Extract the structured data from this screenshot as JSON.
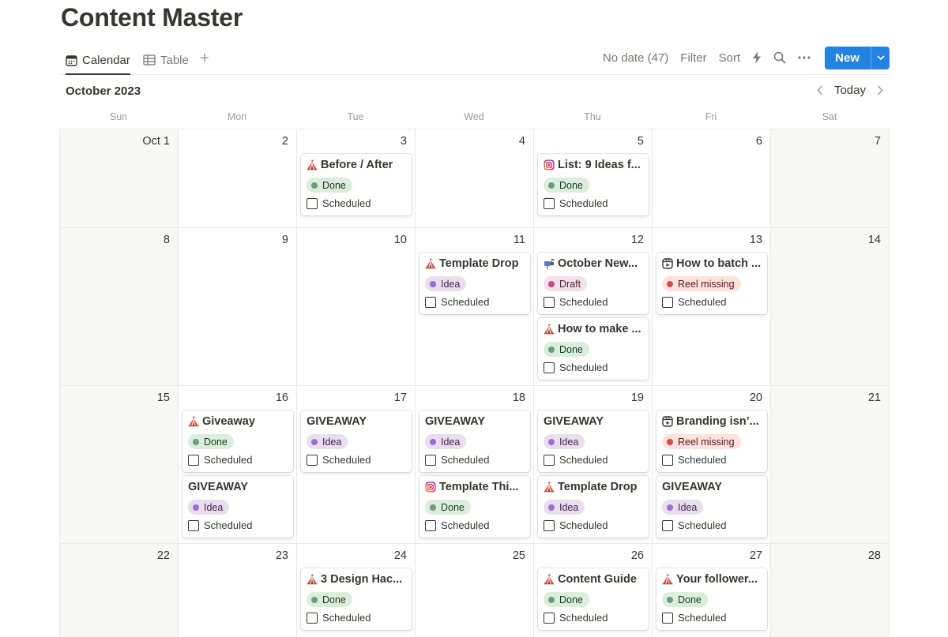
{
  "page": {
    "title": "Content Master"
  },
  "views": {
    "tabs": [
      {
        "label": "Calendar",
        "icon": "calendar-icon",
        "active": true
      },
      {
        "label": "Table",
        "icon": "table-icon",
        "active": false
      }
    ],
    "add_view": "+"
  },
  "toolbar": {
    "no_date": "No date (47)",
    "filter": "Filter",
    "sort": "Sort",
    "new_label": "New"
  },
  "calendar": {
    "month_label": "October 2023",
    "today_label": "Today",
    "weekdays": [
      "Sun",
      "Mon",
      "Tue",
      "Wed",
      "Thu",
      "Fri",
      "Sat"
    ],
    "checkbox_label": "Scheduled",
    "status_colors": {
      "Done": "#dbeddb",
      "Idea": "#e8deee",
      "Draft": "#f5e0e9",
      "Reel missing": "#ffe2dd"
    },
    "weeks": [
      {
        "days": [
          {
            "label": "Oct 1",
            "weekend": true,
            "cards": []
          },
          {
            "label": "2",
            "cards": []
          },
          {
            "label": "3",
            "cards": [
              {
                "icon": "tent-icon",
                "title": "Before / After",
                "status": "Done",
                "kind": "done"
              }
            ]
          },
          {
            "label": "4",
            "cards": []
          },
          {
            "label": "5",
            "cards": [
              {
                "icon": "instagram-icon",
                "title": "List: 9 Ideas f...",
                "status": "Done",
                "kind": "done"
              }
            ]
          },
          {
            "label": "6",
            "cards": []
          },
          {
            "label": "7",
            "weekend": true,
            "cards": []
          }
        ]
      },
      {
        "days": [
          {
            "label": "8",
            "weekend": true,
            "cards": []
          },
          {
            "label": "9",
            "cards": []
          },
          {
            "label": "10",
            "cards": []
          },
          {
            "label": "11",
            "cards": [
              {
                "icon": "tent-icon",
                "title": "Template Drop",
                "status": "Idea",
                "kind": "idea"
              }
            ]
          },
          {
            "label": "12",
            "cards": [
              {
                "icon": "mailbox-icon",
                "title": "October New...",
                "status": "Draft",
                "kind": "draft"
              },
              {
                "icon": "tent-icon",
                "title": "How to make ...",
                "status": "Done",
                "kind": "done"
              }
            ]
          },
          {
            "label": "13",
            "cards": [
              {
                "icon": "reel-icon",
                "title": "How to batch ...",
                "status": "Reel missing",
                "kind": "reel"
              }
            ]
          },
          {
            "label": "14",
            "weekend": true,
            "cards": []
          }
        ]
      },
      {
        "days": [
          {
            "label": "15",
            "weekend": true,
            "cards": []
          },
          {
            "label": "16",
            "cards": [
              {
                "icon": "tent-icon",
                "title": "Giveaway",
                "status": "Done",
                "kind": "done"
              },
              {
                "icon": "",
                "title": "GIVEAWAY",
                "status": "Idea",
                "kind": "idea"
              }
            ]
          },
          {
            "label": "17",
            "cards": [
              {
                "icon": "",
                "title": "GIVEAWAY",
                "status": "Idea",
                "kind": "idea"
              }
            ]
          },
          {
            "label": "18",
            "cards": [
              {
                "icon": "",
                "title": "GIVEAWAY",
                "status": "Idea",
                "kind": "idea"
              },
              {
                "icon": "instagram-icon",
                "title": "Template Thi...",
                "status": "Done",
                "kind": "done"
              }
            ]
          },
          {
            "label": "19",
            "cards": [
              {
                "icon": "",
                "title": "GIVEAWAY",
                "status": "Idea",
                "kind": "idea"
              },
              {
                "icon": "tent-icon",
                "title": "Template Drop",
                "status": "Idea",
                "kind": "idea"
              }
            ]
          },
          {
            "label": "20",
            "cards": [
              {
                "icon": "reel-icon",
                "title": "Branding isn’...",
                "status": "Reel missing",
                "kind": "reel"
              },
              {
                "icon": "",
                "title": "GIVEAWAY",
                "status": "Idea",
                "kind": "idea"
              }
            ]
          },
          {
            "label": "21",
            "weekend": true,
            "cards": []
          }
        ]
      },
      {
        "days": [
          {
            "label": "22",
            "weekend": true,
            "cards": []
          },
          {
            "label": "23",
            "cards": []
          },
          {
            "label": "24",
            "cards": [
              {
                "icon": "tent-icon",
                "title": "3 Design Hac...",
                "status": "Done",
                "kind": "done"
              }
            ]
          },
          {
            "label": "25",
            "cards": []
          },
          {
            "label": "26",
            "cards": [
              {
                "icon": "tent-icon",
                "title": "Content Guide",
                "status": "Done",
                "kind": "done"
              }
            ]
          },
          {
            "label": "27",
            "cards": [
              {
                "icon": "tent-icon",
                "title": "Your follower...",
                "status": "Done",
                "kind": "done"
              }
            ]
          },
          {
            "label": "28",
            "weekend": true,
            "cards": []
          }
        ]
      }
    ]
  }
}
